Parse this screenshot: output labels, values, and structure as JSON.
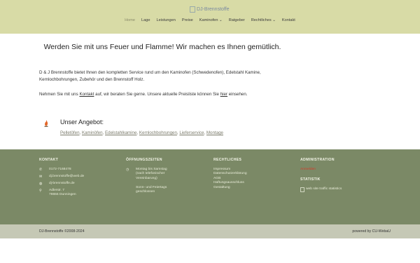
{
  "header": {
    "logo_alt": "DJ-Brennstoffe",
    "nav": [
      {
        "label": "Home",
        "active": true
      },
      {
        "label": "Lage"
      },
      {
        "label": "Leistungen"
      },
      {
        "label": "Preise"
      },
      {
        "label": "Kaminofen ⌄"
      },
      {
        "label": "Ratgeber"
      },
      {
        "label": "Rechtliches ⌄"
      },
      {
        "label": "Kontakt"
      }
    ]
  },
  "main": {
    "headline": "Werden Sie mit uns Feuer und Flamme! Wir machen es Ihnen gemütlich.",
    "intro": "D & J Brennstoffe bietet Ihnen den kompletten Service rund um den Kaminofen (Schwedenofen), Edelstahl Kamine, Kernlochbohrungen, Zubehör und den Brennstoff Holz.",
    "contact_prefix": "Nehmen Sie mit uns ",
    "contact_link": "Kontakt",
    "contact_mid": " auf, wir beraten Sie gerne. Unsere aktuelle Preisliste können Sie ",
    "contact_link2": "hier",
    "contact_suffix": " einsehen.",
    "offer_title": "Unser Angebot:",
    "offers": [
      "Pelletöfen",
      "Kaminöfen",
      "Edelstahlkamine",
      "Kernlochbohrungen",
      "Lieferservice",
      "Montage"
    ]
  },
  "footer": {
    "kontakt": {
      "heading": "KONTAKT",
      "phone": "0172-7168478",
      "email": "dj.brennstoffe@web.de",
      "web": "dj-brennstoffe.de",
      "street": "Adlerstr. 7",
      "city": "78655 Dunningen"
    },
    "hours": {
      "heading": "ÖFFNUNGSZEITEN",
      "line1": "Montag bis Samstag",
      "line2": "(nach telefonischer",
      "line3": "Vereinbarung)",
      "line4": "Sonn- und Feiertags",
      "line5": "geschlossen"
    },
    "legal": {
      "heading": "RECHTLICHES",
      "items": [
        "Impressum",
        "Datenschutzerklärung",
        "AGB",
        "Haftungsausschluss",
        "Gestaltung"
      ]
    },
    "admin": {
      "heading": "ADMINISTRATION",
      "login": "Anmelden",
      "stat_heading": "STATISTIK",
      "stat_alt": "web site traffic statistics"
    }
  },
  "bottom": {
    "copyright": "DJ-Brennstoffe ©2008-2024",
    "powered": "powered by CU-WebaU"
  },
  "colors": {
    "header_bg": "#d8dba6",
    "footer_bg": "#7b8966",
    "bottom_bg": "#c5c8b5",
    "login_red": "#d43a2a"
  }
}
